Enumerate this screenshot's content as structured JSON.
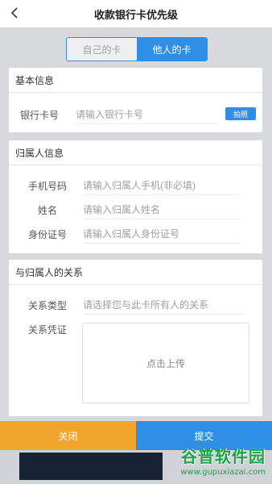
{
  "header": {
    "title": "收款银行卡优先级",
    "back_icon": "chevron-left-icon"
  },
  "tabs": {
    "own": "自己的卡",
    "others": "他人的卡",
    "active": "others"
  },
  "basic_info": {
    "title": "基本信息",
    "card_label": "银行卡号",
    "card_placeholder": "请输入银行卡号",
    "photo_button": "拍照"
  },
  "owner_info": {
    "title": "归属人信息",
    "phone_label": "手机号码",
    "phone_placeholder": "请输入归属人手机(非必填)",
    "name_label": "姓名",
    "name_placeholder": "请输入归属人姓名",
    "id_label": "身份证号",
    "id_placeholder": "请输入归属人身份证号"
  },
  "relation": {
    "title": "与归属人的关系",
    "type_label": "关系类型",
    "type_placeholder": "请选择您与此卡所有人的关系",
    "proof_label": "关系凭证",
    "upload_text": "点击上传"
  },
  "footer": {
    "close": "关闭",
    "submit": "提交"
  },
  "watermark": {
    "name": "谷普软件园",
    "url": "www.gupuxiazai.com"
  },
  "colors": {
    "primary": "#2f8fe6",
    "close": "#f0a52c",
    "watermark": "#1aa34a"
  }
}
